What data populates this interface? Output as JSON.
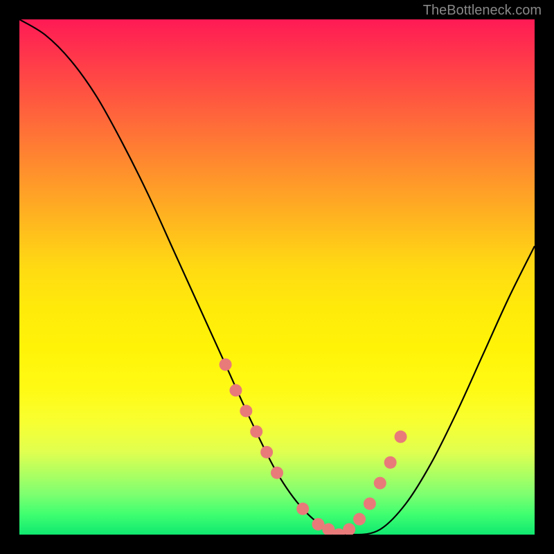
{
  "watermark": "TheBottleneck.com",
  "chart_data": {
    "type": "line",
    "title": "",
    "xlabel": "",
    "ylabel": "",
    "ylim": [
      0,
      100
    ],
    "xlim": [
      0,
      100
    ],
    "series": [
      {
        "name": "curve",
        "x": [
          0,
          5,
          10,
          15,
          20,
          25,
          30,
          35,
          40,
          45,
          50,
          55,
          60,
          65,
          70,
          75,
          80,
          85,
          90,
          95,
          100
        ],
        "y": [
          100,
          97,
          92,
          85,
          76,
          66,
          55,
          44,
          33,
          22,
          12,
          5,
          1,
          0,
          1,
          6,
          14,
          24,
          35,
          46,
          56
        ]
      }
    ],
    "markers": {
      "name": "highlighted-points",
      "color": "#e87a7a",
      "x": [
        40,
        42,
        44,
        46,
        48,
        50,
        55,
        58,
        60,
        62,
        64,
        66,
        68,
        70,
        72,
        74
      ],
      "y": [
        33,
        28,
        24,
        20,
        16,
        12,
        5,
        2,
        1,
        0,
        1,
        3,
        6,
        10,
        14,
        19
      ]
    }
  }
}
